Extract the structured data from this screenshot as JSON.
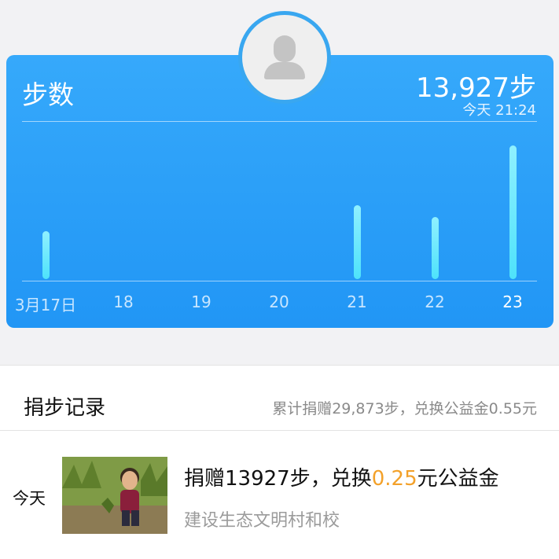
{
  "steps_card": {
    "title": "步数",
    "total": "13,927步",
    "time": "今天 21:24",
    "chart_data": {
      "type": "bar",
      "categories": [
        "3月17日",
        "18",
        "19",
        "20",
        "21",
        "22",
        "23"
      ],
      "values": [
        3700,
        0,
        0,
        0,
        5700,
        4800,
        10300
      ],
      "active_index": 6,
      "bar_color": "#6ee8fc"
    }
  },
  "records": {
    "title": "捐步记录",
    "summary": "累计捐赠29,873步，兑换公益金0.55元",
    "items": [
      {
        "date": "今天",
        "main_prefix": "捐赠13927步，兑换",
        "amount": "0.25",
        "main_suffix": "元公益金",
        "project": "建设生态文明村和校"
      }
    ]
  },
  "colors": {
    "card_blue": "#2a9ff8",
    "accent_orange": "#f3a12a"
  },
  "icons": {
    "avatar": "default-user-avatar-icon"
  }
}
